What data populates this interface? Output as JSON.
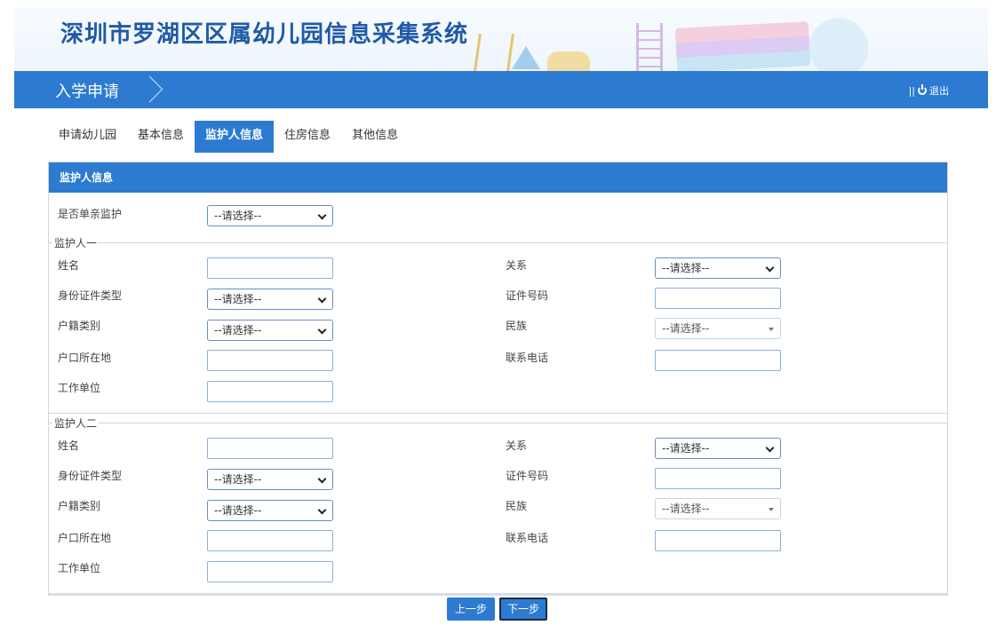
{
  "header": {
    "title": "深圳市罗湖区区属幼儿园信息采集系统"
  },
  "nav": {
    "section": "入学申请",
    "logout_label": "退出",
    "logout_prefix": "||"
  },
  "tabs": [
    {
      "label": "申请幼儿园",
      "active": false
    },
    {
      "label": "基本信息",
      "active": false
    },
    {
      "label": "监护人信息",
      "active": true
    },
    {
      "label": "住房信息",
      "active": false
    },
    {
      "label": "其他信息",
      "active": false
    }
  ],
  "panel": {
    "heading": "监护人信息",
    "single_parent_label": "是否单亲监护",
    "single_parent_value": "--请选择--"
  },
  "guardians": [
    {
      "legend": "监护人一",
      "fields": {
        "name_label": "姓名",
        "relation_label": "关系",
        "relation_value": "--请选择--",
        "idtype_label": "身份证件类型",
        "idtype_value": "--请选择--",
        "idno_label": "证件号码",
        "hukou_label": "户籍类别",
        "hukou_value": "--请选择--",
        "ethnic_label": "民族",
        "ethnic_value": "--请选择--",
        "hukou_place_label": "户口所在地",
        "phone_label": "联系电话",
        "work_label": "工作单位"
      }
    },
    {
      "legend": "监护人二",
      "fields": {
        "name_label": "姓名",
        "relation_label": "关系",
        "relation_value": "--请选择--",
        "idtype_label": "身份证件类型",
        "idtype_value": "--请选择--",
        "idno_label": "证件号码",
        "hukou_label": "户籍类别",
        "hukou_value": "--请选择--",
        "ethnic_label": "民族",
        "ethnic_value": "--请选择--",
        "hukou_place_label": "户口所在地",
        "phone_label": "联系电话",
        "work_label": "工作单位"
      }
    }
  ],
  "buttons": {
    "prev": "上一步",
    "next": "下一步"
  }
}
